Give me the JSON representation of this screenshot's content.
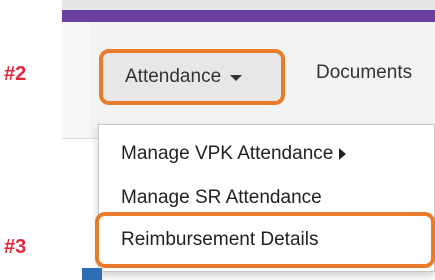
{
  "annotations": {
    "step_2": "#2",
    "step_3": "#3"
  },
  "navbar": {
    "tabs": [
      {
        "label": "Attendance",
        "has_caret": true
      },
      {
        "label": "Documents"
      }
    ]
  },
  "attendance_menu": {
    "items": [
      {
        "label": "Manage VPK Attendance",
        "has_submenu": true
      },
      {
        "label": "Manage SR Attendance"
      },
      {
        "label": "Reimbursement Details"
      }
    ]
  },
  "colors": {
    "highlight_border": "#e87c2a",
    "step_label": "#e3263a",
    "top_bar": "#6a3fa0"
  }
}
